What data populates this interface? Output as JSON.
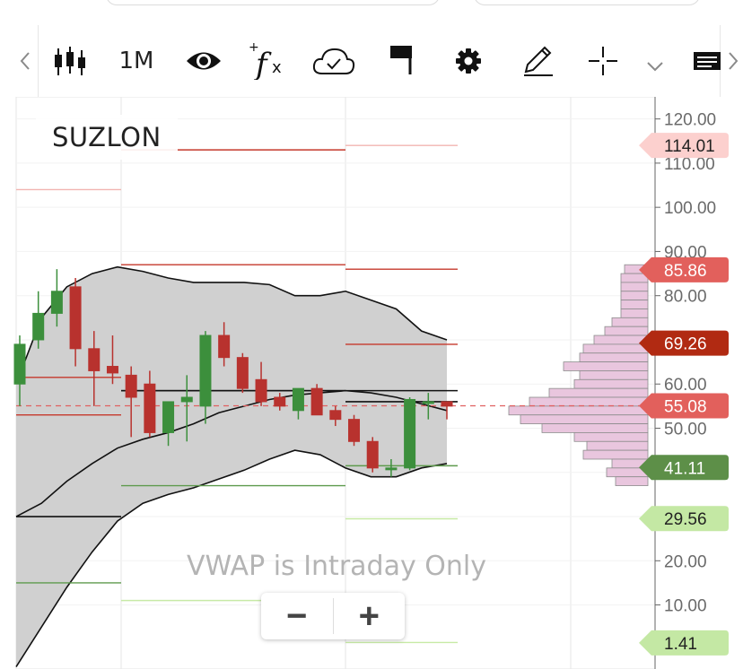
{
  "toolbar": {
    "scroll_left_icon": "chevron-left-icon",
    "candles_icon": "candlestick-icon",
    "timeframe": "1M",
    "eye_icon": "eye-icon",
    "fx_icon": "fx-icon",
    "cloud_icon": "cloud-check-icon",
    "flag_icon": "flag-icon",
    "gear_icon": "gear-icon",
    "pencil_icon": "pencil-icon",
    "crosshair_icon": "crosshair-icon",
    "more_icon": "chevron-down-icon",
    "panel_icon": "list-panel-icon",
    "scroll_right_icon": "chevron-right-icon"
  },
  "chart": {
    "symbol": "SUZLON",
    "vwap_message": "VWAP is Intraday Only",
    "zoom_out_label": "−",
    "zoom_in_label": "+"
  },
  "chart_data": {
    "type": "candlestick",
    "title": "SUZLON",
    "ylim": [
      -4.5,
      125
    ],
    "y_ticks": [
      "10.00",
      "20.00",
      "30.00",
      "40.00",
      "50.00",
      "60.00",
      "70.00",
      "80.00",
      "90.00",
      "100.00",
      "110.00",
      "120.00"
    ],
    "up_color": "#3c8f3c",
    "down_color": "#b8322e",
    "candles": [
      {
        "o": 60.0,
        "h": 71.0,
        "l": 55.0,
        "c": 69.0
      },
      {
        "o": 70.0,
        "h": 81.0,
        "l": 68.0,
        "c": 76.0
      },
      {
        "o": 76.0,
        "h": 86.0,
        "l": 73.0,
        "c": 81.0
      },
      {
        "o": 82.0,
        "h": 84.0,
        "l": 64.0,
        "c": 68.0
      },
      {
        "o": 68.0,
        "h": 72.0,
        "l": 55.0,
        "c": 63.0
      },
      {
        "o": 64.0,
        "h": 71.0,
        "l": 60.0,
        "c": 62.5
      },
      {
        "o": 62.0,
        "h": 64.0,
        "l": 48.0,
        "c": 57.0
      },
      {
        "o": 60.0,
        "h": 63.0,
        "l": 48.0,
        "c": 49.0
      },
      {
        "o": 49.0,
        "h": 55.0,
        "l": 46.0,
        "c": 56.0
      },
      {
        "o": 56.0,
        "h": 62.0,
        "l": 47.0,
        "c": 57.0
      },
      {
        "o": 55.0,
        "h": 72.0,
        "l": 51.0,
        "c": 71.0
      },
      {
        "o": 71.0,
        "h": 74.0,
        "l": 64.0,
        "c": 66.0
      },
      {
        "o": 66.0,
        "h": 67.0,
        "l": 58.0,
        "c": 59.0
      },
      {
        "o": 61.0,
        "h": 65.0,
        "l": 55.0,
        "c": 56.0
      },
      {
        "o": 57.0,
        "h": 58.0,
        "l": 54.0,
        "c": 55.0
      },
      {
        "o": 54.0,
        "h": 59.0,
        "l": 52.0,
        "c": 59.0
      },
      {
        "o": 59.0,
        "h": 60.0,
        "l": 53.0,
        "c": 53.0
      },
      {
        "o": 54.0,
        "h": 55.0,
        "l": 50.5,
        "c": 52.0
      },
      {
        "o": 52.0,
        "h": 53.0,
        "l": 46.0,
        "c": 47.0
      },
      {
        "o": 47.0,
        "h": 48.0,
        "l": 40.0,
        "c": 41.0
      },
      {
        "o": 41.0,
        "h": 43.0,
        "l": 39.0,
        "c": 41.0
      },
      {
        "o": 41.0,
        "h": 57.0,
        "l": 40.5,
        "c": 56.5
      },
      {
        "o": 56.0,
        "h": 58.0,
        "l": 52.0,
        "c": 56.0
      },
      {
        "o": 56.0,
        "h": 56.0,
        "l": 52.0,
        "c": 55.0
      }
    ],
    "bollinger": {
      "upper": [
        60,
        75,
        82,
        85,
        86.5,
        85.5,
        84,
        83,
        83,
        83,
        82.5,
        80,
        80,
        81,
        79,
        77,
        72,
        70
      ],
      "middle": [
        30,
        33,
        38,
        42,
        45.5,
        47.5,
        49,
        51,
        53.5,
        55,
        56.5,
        57.5,
        58,
        58.5,
        58,
        57,
        55.5,
        54
      ],
      "lower": [
        -4,
        5,
        14,
        22,
        29,
        33,
        35,
        36.5,
        38.5,
        40.5,
        43,
        45,
        44,
        41,
        39,
        39,
        41,
        42
      ]
    },
    "levels": {
      "pivot": [
        30.0,
        58.5,
        56.0
      ],
      "resistance_1": [
        53.0,
        87.0,
        69.0
      ],
      "resistance_2": [
        61.5,
        113.0,
        86.0
      ],
      "resistance_3": [
        104.0,
        0,
        114.0
      ],
      "support_1": [
        15.0,
        37.0,
        41.5
      ],
      "support_2": [
        0,
        11.0,
        29.5
      ],
      "support_3": [
        0,
        0,
        1.5
      ],
      "band_mid": [
        0,
        58.5,
        58.5
      ]
    },
    "volume_profile": [
      {
        "price": 86.0,
        "width": 26
      },
      {
        "price": 84.0,
        "width": 30
      },
      {
        "price": 82.0,
        "width": 30
      },
      {
        "price": 80.0,
        "width": 30
      },
      {
        "price": 78.0,
        "width": 30
      },
      {
        "price": 76.0,
        "width": 30
      },
      {
        "price": 74.0,
        "width": 40
      },
      {
        "price": 72.0,
        "width": 48
      },
      {
        "price": 70.0,
        "width": 60
      },
      {
        "price": 68.0,
        "width": 72
      },
      {
        "price": 66.0,
        "width": 76
      },
      {
        "price": 64.0,
        "width": 94
      },
      {
        "price": 62.0,
        "width": 76
      },
      {
        "price": 60.0,
        "width": 82
      },
      {
        "price": 58.0,
        "width": 110
      },
      {
        "price": 56.0,
        "width": 132
      },
      {
        "price": 54.0,
        "width": 155
      },
      {
        "price": 52.0,
        "width": 142
      },
      {
        "price": 50.0,
        "width": 118
      },
      {
        "price": 48.0,
        "width": 82
      },
      {
        "price": 46.0,
        "width": 68
      },
      {
        "price": 44.0,
        "width": 72
      },
      {
        "price": 42.0,
        "width": 40
      },
      {
        "price": 40.0,
        "width": 46
      },
      {
        "price": 38.0,
        "width": 36
      }
    ],
    "last_price": 55.08,
    "price_badges": [
      {
        "price": 114.01,
        "label": "114.01",
        "bg": "#fcd0ce",
        "fg": "#222222"
      },
      {
        "price": 85.86,
        "label": "85.86",
        "bg": "#e2605c",
        "fg": "#ffffff"
      },
      {
        "price": 69.26,
        "label": "69.26",
        "bg": "#b12a12",
        "fg": "#ffffff"
      },
      {
        "price": 55.08,
        "label": "55.08",
        "bg": "#e2605c",
        "fg": "#ffffff"
      },
      {
        "price": 41.11,
        "label": "41.11",
        "bg": "#5d8f48",
        "fg": "#ffffff"
      },
      {
        "price": 29.56,
        "label": "29.56",
        "bg": "#c4e8a4",
        "fg": "#222222"
      },
      {
        "price": 1.41,
        "label": "1.41",
        "bg": "#c4e8a4",
        "fg": "#222222"
      }
    ],
    "colors": {
      "band_fill": "#d0d0d0",
      "pivot": "#111111",
      "resistance": "#c5382b",
      "resistance_light": "#f2b4b0",
      "support": "#5e9a4d",
      "support_light": "#c7eaa6",
      "last_price_line": "#e06060",
      "profile_fill": "#e9c6de",
      "profile_stroke": "#8c8c8c",
      "axis_text": "#6a6a6a",
      "grid": "#e6e6e6"
    }
  }
}
